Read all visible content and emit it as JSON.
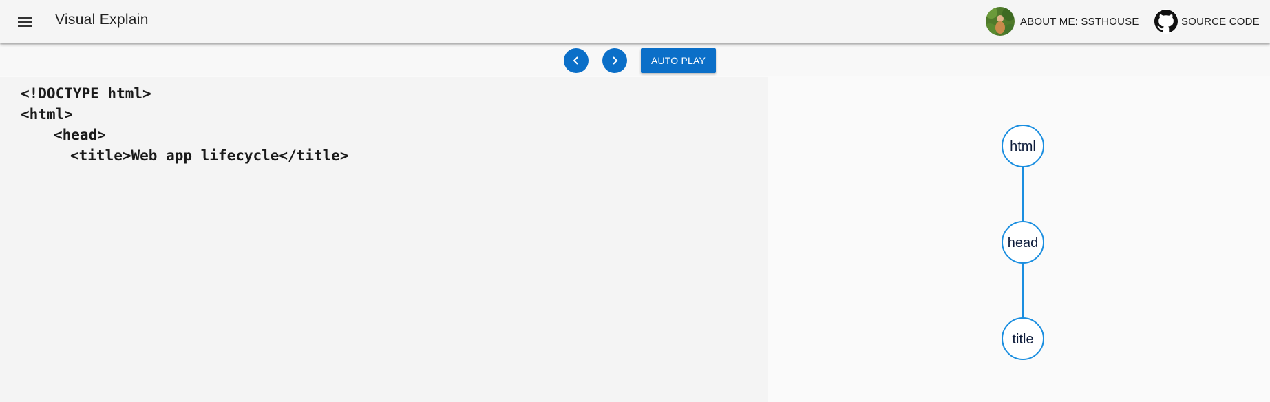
{
  "header": {
    "title": "Visual Explain",
    "menu_icon": "hamburger-menu-icon",
    "about_label": "ABOUT ME: SSTHOUSE",
    "source_label": "SOURCE CODE"
  },
  "controls": {
    "prev_icon": "chevron-left-icon",
    "next_icon": "chevron-right-icon",
    "autoplay_label": "AUTO PLAY",
    "accent_color": "#0b6fc8"
  },
  "code": {
    "lines": [
      "<!DOCTYPE html>",
      "<html>",
      "<head>",
      "<title>Web app lifecycle</title>"
    ]
  },
  "tree": {
    "nodes": [
      "html",
      "head",
      "title"
    ],
    "node_color": "#1a8ee0"
  }
}
